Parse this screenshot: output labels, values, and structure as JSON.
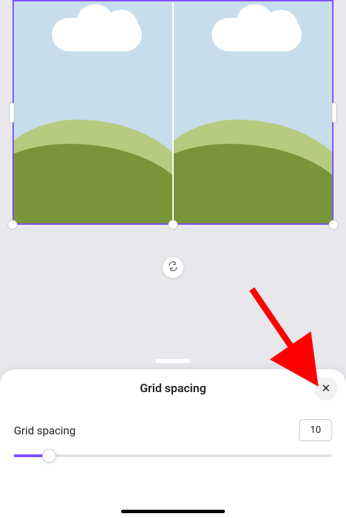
{
  "panel": {
    "title": "Grid spacing",
    "control_label": "Grid spacing",
    "value": "10"
  },
  "colors": {
    "accent": "#7d4cff",
    "arrow": "#ff0000"
  }
}
